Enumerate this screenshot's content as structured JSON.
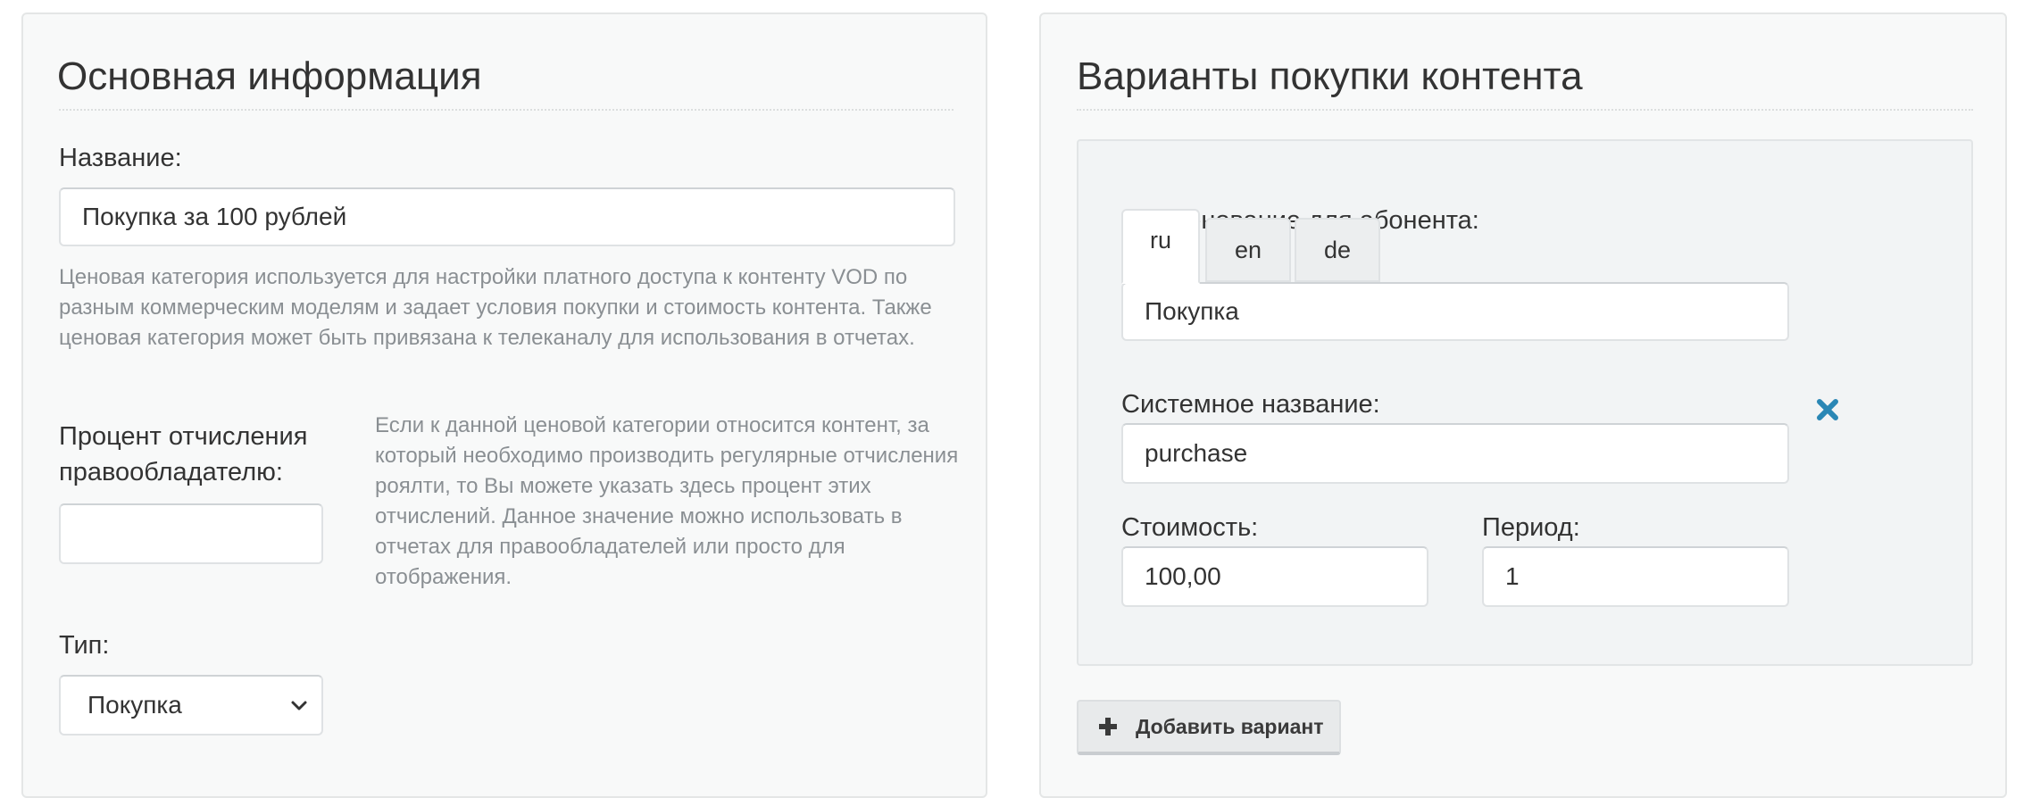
{
  "basic_info": {
    "title": "Основная информация",
    "name_label": "Название:",
    "name_value": "Покупка за 100 рублей",
    "name_help": "Ценовая категория используется для настройки платного доступа к контенту VOD по разным коммерческим моделям и задает условия покупки и стоимость контента. Также ценовая категория может быть привязана к телеканалу для использования в отчетах.",
    "royalty_label_line1": "Процент отчисления",
    "royalty_label_line2": "правообладателю:",
    "royalty_value": "",
    "royalty_help": "Если к данной ценовой категории относится контент, за который необходимо производить регулярные отчисления роялти, то Вы можете указать здесь процент этих отчислений. Данное значение можно использовать в отчетах для правообладателей или просто для отображения.",
    "type_label": "Тип:",
    "type_selected": "Покупка"
  },
  "purchase_options": {
    "title": "Варианты покупки контента",
    "variant": {
      "subscriber_name_label": "Наименование для абонента:",
      "tabs": [
        {
          "label": "ru",
          "active": true
        },
        {
          "label": "en",
          "active": false
        },
        {
          "label": "de",
          "active": false
        }
      ],
      "subscriber_name_value": "Покупка",
      "system_name_label": "Системное название:",
      "system_name_value": "purchase",
      "cost_label": "Стоимость:",
      "cost_value": "100,00",
      "period_label": "Период:",
      "period_value": "1"
    },
    "add_button_label": "Добавить вариант"
  },
  "icons": {
    "remove": "close-x-icon",
    "add": "plus-icon",
    "dropdown": "chevron-down-icon"
  },
  "colors": {
    "remove_icon": "#2a87b5",
    "panel_bg": "#f8f9f9",
    "help_text": "#8a8f93"
  }
}
